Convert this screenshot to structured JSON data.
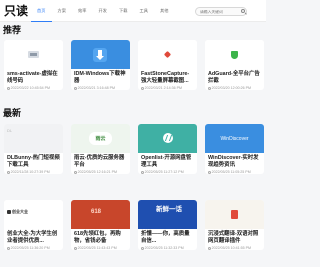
{
  "header": {
    "logo": "只读",
    "nav": [
      {
        "label": "首页",
        "active": true
      },
      {
        "label": "方案",
        "active": false
      },
      {
        "label": "效率",
        "active": false
      },
      {
        "label": "开发",
        "active": false
      },
      {
        "label": "下载",
        "active": false
      },
      {
        "label": "工具",
        "active": false
      },
      {
        "label": "其他",
        "active": false
      }
    ],
    "search_placeholder": "请输入关键词"
  },
  "sections": {
    "recommended_title": "推荐",
    "latest_title": "最新"
  },
  "recommended": [
    {
      "title": "sms-activate-虚拟在线号码",
      "time": "2022/03/22 10:45:54 PM",
      "thumb_icon": "sms-icon"
    },
    {
      "title": "IDM-Windows下载神器",
      "time": "2022/03/21 3:16:48 PM",
      "thumb_icon": "download-icon"
    },
    {
      "title": "FastStoneCapture-强大轻量屏幕截图...",
      "time": "2022/03/21 2:14:36 PM",
      "thumb_icon": "capture-icon"
    },
    {
      "title": "AdGuard-全平台广告拦截",
      "time": "2022/03/20 12:00:26 PM",
      "thumb_icon": "shield-icon"
    }
  ],
  "latest_row1": [
    {
      "title": "DLBunny-热门短视频下载工具",
      "time": "2022/11/28 10:27:39 PM",
      "thumb_icon": "video-icon",
      "thumb_label": "DL"
    },
    {
      "title": "雨云-优质的云服务器平台",
      "time": "2022/05/25 12:16:21 PM",
      "thumb_icon": "cloud-icon",
      "thumb_label": "雨云"
    },
    {
      "title": "Openlist-开源网盘管理工具",
      "time": "2022/05/25 11:27:12 PM",
      "thumb_icon": "openlist-icon"
    },
    {
      "title": "WinDiscover-实时发现趋势资讯",
      "time": "2022/05/25 11:05:25 PM",
      "thumb_icon": "windiscover-icon",
      "thumb_label": "WinDiscover"
    }
  ],
  "latest_row2": [
    {
      "title": "创业大全-为大学生创业者提供优质...",
      "time": "2022/05/25 11:36:20 PM",
      "thumb_icon": "startup-icon",
      "thumb_label": "创业大全"
    },
    {
      "title": "618先领红包，再购物，省钱必备",
      "time": "2022/05/25 11:43:43 PM",
      "thumb_icon": "redpacket-icon",
      "thumb_label": "618"
    },
    {
      "title": "折懂——你，高质量自信...",
      "time": "2022/05/25 11:32:33 PM",
      "thumb_icon": "xing-icon",
      "thumb_label": "新鲜一话"
    },
    {
      "title": "沉浸式翻译-双语对照网页翻译插件",
      "time": "2022/05/25 10:41:55 PM",
      "thumb_icon": "translate-icon"
    }
  ],
  "colors": {
    "accent": "#2f7df6",
    "background": "#f5f6f8",
    "card": "#ffffff"
  }
}
